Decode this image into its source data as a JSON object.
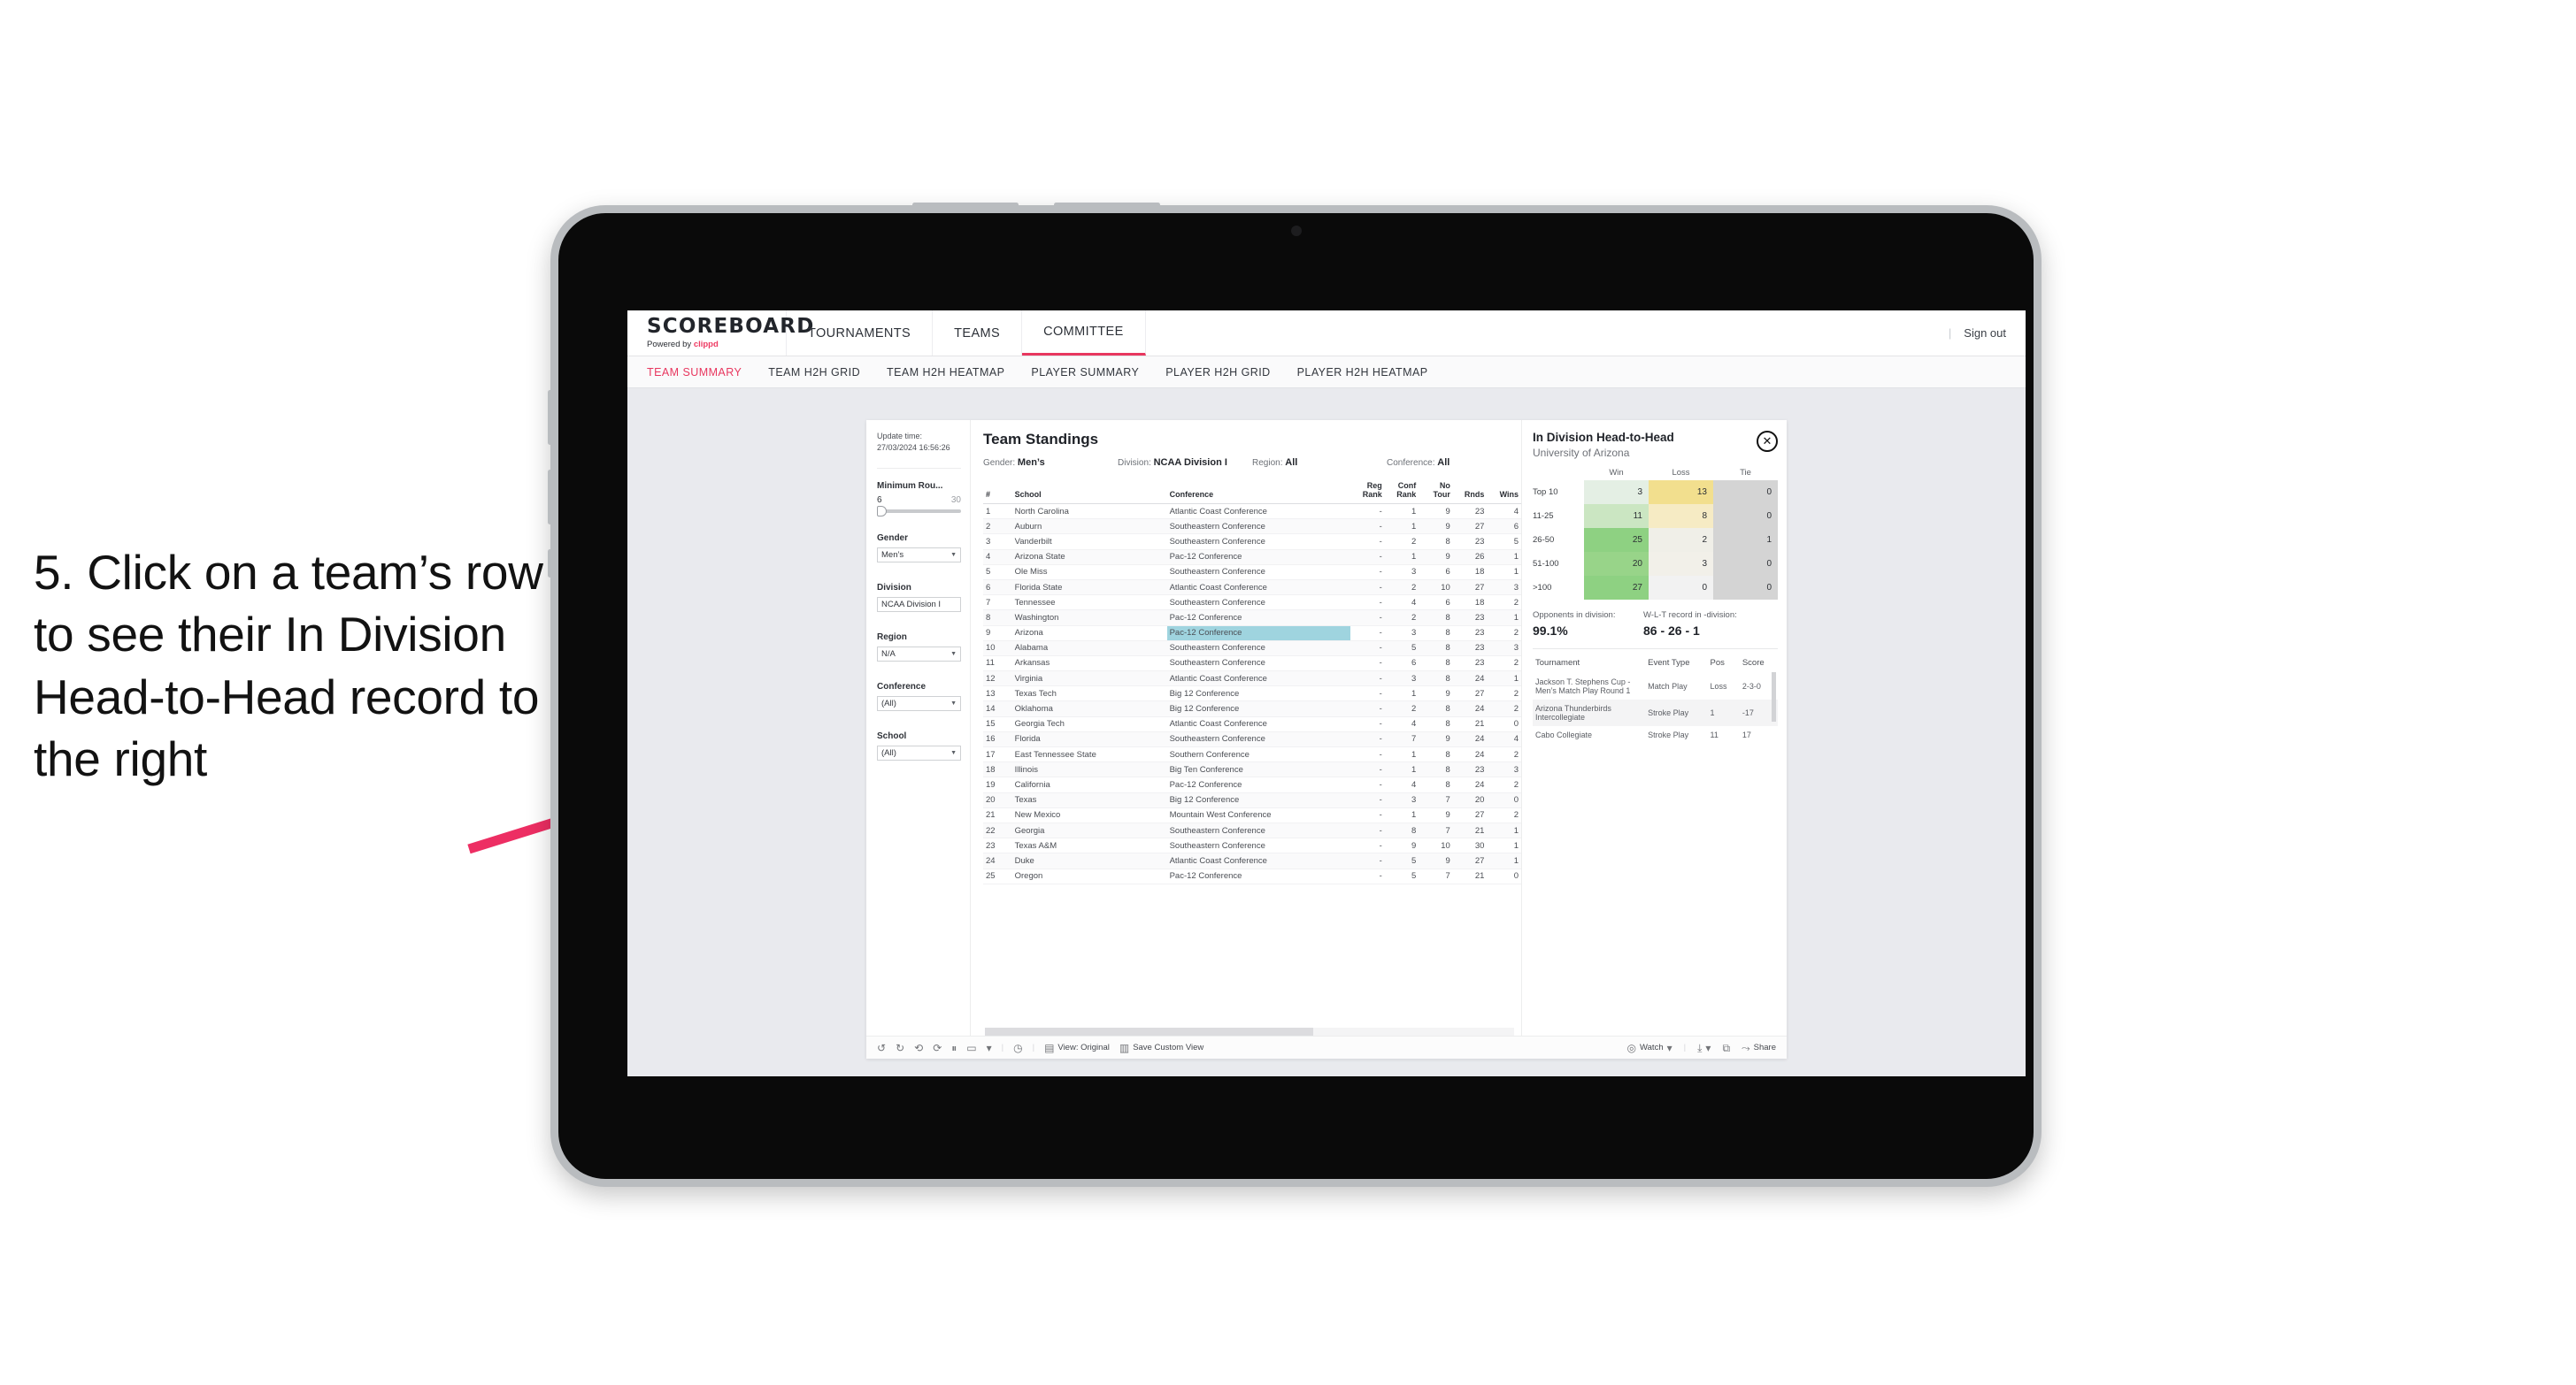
{
  "annotation": {
    "text": "5. Click on a team’s row to see their In Division Head-to-Head record to the right",
    "arrow_color": "#ed2e63"
  },
  "topnav": {
    "brand_name": "SCOREBOARD",
    "brand_sub_prefix": "Powered by ",
    "brand_sub_brand": "clippd",
    "items": [
      {
        "label": "TOURNAMENTS",
        "active": false
      },
      {
        "label": "TEAMS",
        "active": false
      },
      {
        "label": "COMMITTEE",
        "active": true
      }
    ],
    "divider": "|",
    "sign_out": "Sign out",
    "accent": "#e8375f"
  },
  "subnav": {
    "items": [
      {
        "label": "TEAM SUMMARY",
        "active": true
      },
      {
        "label": "TEAM H2H GRID",
        "active": false
      },
      {
        "label": "TEAM H2H HEATMAP",
        "active": false
      },
      {
        "label": "PLAYER SUMMARY",
        "active": false
      },
      {
        "label": "PLAYER H2H GRID",
        "active": false
      },
      {
        "label": "PLAYER H2H HEATMAP",
        "active": false
      }
    ]
  },
  "filters": {
    "update_time_label": "Update time:",
    "update_time_value": "27/03/2024 16:56:26",
    "slider": {
      "label": "Minimum Rou...",
      "min": "6",
      "max": "30"
    },
    "groups": [
      {
        "label": "Gender",
        "value": "Men’s"
      },
      {
        "label": "Division",
        "value": "NCAA Division I"
      },
      {
        "label": "Region",
        "value": "N/A"
      },
      {
        "label": "Conference",
        "value": "(All)"
      },
      {
        "label": "School",
        "value": "(All)"
      }
    ]
  },
  "standings": {
    "title": "Team Standings",
    "filter_summary": [
      {
        "label": "Gender:",
        "value": "Men’s"
      },
      {
        "label": "Division:",
        "value": "NCAA Division I"
      },
      {
        "label": "Region:",
        "value": "All"
      },
      {
        "label": "Conference:",
        "value": "All"
      }
    ],
    "columns": [
      "#",
      "School",
      "Conference",
      "Reg Rank",
      "Conf Rank",
      "No Tour",
      "Rnds",
      "Wins"
    ],
    "rows": [
      {
        "rank": "1",
        "school": "North Carolina",
        "conference": "Atlantic Coast Conference",
        "reg": "-",
        "conf": "1",
        "tour": "9",
        "rnds": "23",
        "wins": "4",
        "selected": false
      },
      {
        "rank": "2",
        "school": "Auburn",
        "conference": "Southeastern Conference",
        "reg": "-",
        "conf": "1",
        "tour": "9",
        "rnds": "27",
        "wins": "6",
        "selected": false
      },
      {
        "rank": "3",
        "school": "Vanderbilt",
        "conference": "Southeastern Conference",
        "reg": "-",
        "conf": "2",
        "tour": "8",
        "rnds": "23",
        "wins": "5",
        "selected": false
      },
      {
        "rank": "4",
        "school": "Arizona State",
        "conference": "Pac-12 Conference",
        "reg": "-",
        "conf": "1",
        "tour": "9",
        "rnds": "26",
        "wins": "1",
        "selected": false
      },
      {
        "rank": "5",
        "school": "Ole Miss",
        "conference": "Southeastern Conference",
        "reg": "-",
        "conf": "3",
        "tour": "6",
        "rnds": "18",
        "wins": "1",
        "selected": false
      },
      {
        "rank": "6",
        "school": "Florida State",
        "conference": "Atlantic Coast Conference",
        "reg": "-",
        "conf": "2",
        "tour": "10",
        "rnds": "27",
        "wins": "3",
        "selected": false
      },
      {
        "rank": "7",
        "school": "Tennessee",
        "conference": "Southeastern Conference",
        "reg": "-",
        "conf": "4",
        "tour": "6",
        "rnds": "18",
        "wins": "2",
        "selected": false
      },
      {
        "rank": "8",
        "school": "Washington",
        "conference": "Pac-12 Conference",
        "reg": "-",
        "conf": "2",
        "tour": "8",
        "rnds": "23",
        "wins": "1",
        "selected": false
      },
      {
        "rank": "9",
        "school": "Arizona",
        "conference": "Pac-12 Conference",
        "reg": "-",
        "conf": "3",
        "tour": "8",
        "rnds": "23",
        "wins": "2",
        "selected": true
      },
      {
        "rank": "10",
        "school": "Alabama",
        "conference": "Southeastern Conference",
        "reg": "-",
        "conf": "5",
        "tour": "8",
        "rnds": "23",
        "wins": "3",
        "selected": false
      },
      {
        "rank": "11",
        "school": "Arkansas",
        "conference": "Southeastern Conference",
        "reg": "-",
        "conf": "6",
        "tour": "8",
        "rnds": "23",
        "wins": "2",
        "selected": false
      },
      {
        "rank": "12",
        "school": "Virginia",
        "conference": "Atlantic Coast Conference",
        "reg": "-",
        "conf": "3",
        "tour": "8",
        "rnds": "24",
        "wins": "1",
        "selected": false
      },
      {
        "rank": "13",
        "school": "Texas Tech",
        "conference": "Big 12 Conference",
        "reg": "-",
        "conf": "1",
        "tour": "9",
        "rnds": "27",
        "wins": "2",
        "selected": false
      },
      {
        "rank": "14",
        "school": "Oklahoma",
        "conference": "Big 12 Conference",
        "reg": "-",
        "conf": "2",
        "tour": "8",
        "rnds": "24",
        "wins": "2",
        "selected": false
      },
      {
        "rank": "15",
        "school": "Georgia Tech",
        "conference": "Atlantic Coast Conference",
        "reg": "-",
        "conf": "4",
        "tour": "8",
        "rnds": "21",
        "wins": "0",
        "selected": false
      },
      {
        "rank": "16",
        "school": "Florida",
        "conference": "Southeastern Conference",
        "reg": "-",
        "conf": "7",
        "tour": "9",
        "rnds": "24",
        "wins": "4",
        "selected": false
      },
      {
        "rank": "17",
        "school": "East Tennessee State",
        "conference": "Southern Conference",
        "reg": "-",
        "conf": "1",
        "tour": "8",
        "rnds": "24",
        "wins": "2",
        "selected": false
      },
      {
        "rank": "18",
        "school": "Illinois",
        "conference": "Big Ten Conference",
        "reg": "-",
        "conf": "1",
        "tour": "8",
        "rnds": "23",
        "wins": "3",
        "selected": false
      },
      {
        "rank": "19",
        "school": "California",
        "conference": "Pac-12 Conference",
        "reg": "-",
        "conf": "4",
        "tour": "8",
        "rnds": "24",
        "wins": "2",
        "selected": false
      },
      {
        "rank": "20",
        "school": "Texas",
        "conference": "Big 12 Conference",
        "reg": "-",
        "conf": "3",
        "tour": "7",
        "rnds": "20",
        "wins": "0",
        "selected": false
      },
      {
        "rank": "21",
        "school": "New Mexico",
        "conference": "Mountain West Conference",
        "reg": "-",
        "conf": "1",
        "tour": "9",
        "rnds": "27",
        "wins": "2",
        "selected": false
      },
      {
        "rank": "22",
        "school": "Georgia",
        "conference": "Southeastern Conference",
        "reg": "-",
        "conf": "8",
        "tour": "7",
        "rnds": "21",
        "wins": "1",
        "selected": false
      },
      {
        "rank": "23",
        "school": "Texas A&M",
        "conference": "Southeastern Conference",
        "reg": "-",
        "conf": "9",
        "tour": "10",
        "rnds": "30",
        "wins": "1",
        "selected": false
      },
      {
        "rank": "24",
        "school": "Duke",
        "conference": "Atlantic Coast Conference",
        "reg": "-",
        "conf": "5",
        "tour": "9",
        "rnds": "27",
        "wins": "1",
        "selected": false
      },
      {
        "rank": "25",
        "school": "Oregon",
        "conference": "Pac-12 Conference",
        "reg": "-",
        "conf": "5",
        "tour": "7",
        "rnds": "21",
        "wins": "0",
        "selected": false
      }
    ]
  },
  "h2h": {
    "title": "In Division Head-to-Head",
    "subtitle": "University of Arizona",
    "close_label": "✕",
    "chart_data": {
      "type": "heatmap",
      "title": "In Division Head-to-Head",
      "columns": [
        "Win",
        "Loss",
        "Tie"
      ],
      "rows": [
        "Top 10",
        "11-25",
        "26-50",
        "51-100",
        ">100"
      ],
      "values": [
        [
          3,
          13,
          0
        ],
        [
          11,
          8,
          0
        ],
        [
          25,
          2,
          1
        ],
        [
          20,
          3,
          0
        ],
        [
          27,
          0,
          0
        ]
      ],
      "cell_colors": [
        [
          "#e4efe4",
          "#f2df8e",
          "#d4d4d4"
        ],
        [
          "#cbe6c2",
          "#f6ebc4",
          "#d4d4d4"
        ],
        [
          "#8ed182",
          "#f0efe8",
          "#d4d4d4"
        ],
        [
          "#98d489",
          "#f2f0e9",
          "#d4d4d4"
        ],
        [
          "#8ed182",
          "#f2f2f2",
          "#d4d4d4"
        ]
      ]
    },
    "stats": [
      {
        "caption": "Opponents in division:",
        "value": "99.1%"
      },
      {
        "caption": "W-L-T record in -division:",
        "value": "86 - 26 - 1"
      }
    ],
    "tournaments": {
      "columns": [
        "Tournament",
        "Event Type",
        "Pos",
        "Score"
      ],
      "rows": [
        {
          "tournament": "Jackson T. Stephens Cup - Men’s Match Play Round 1",
          "event": "Match Play",
          "pos": "Loss",
          "score": "2-3-0"
        },
        {
          "tournament": "Arizona Thunderbirds Intercollegiate",
          "event": "Stroke Play",
          "pos": "1",
          "score": "-17"
        },
        {
          "tournament": "Cabo Collegiate",
          "event": "Stroke Play",
          "pos": "11",
          "score": "17"
        }
      ]
    }
  },
  "toolbar": {
    "icons": [
      "undo-icon",
      "redo-icon",
      "revert-icon",
      "refresh-icon",
      "pause-icon",
      "rect-select-icon",
      "caret-down-icon",
      "clock-icon"
    ],
    "view_label": "View: Original",
    "save_label": "Save Custom View",
    "watch_label": "Watch",
    "share_label": "Share"
  }
}
